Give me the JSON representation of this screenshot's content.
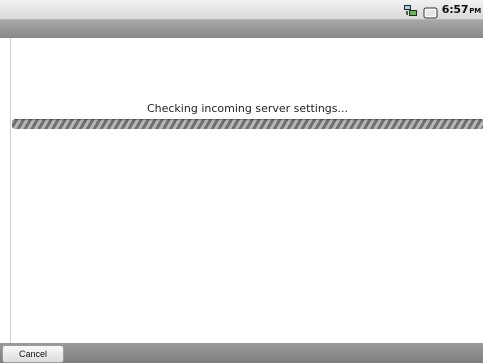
{
  "status_bar": {
    "time": "6:57",
    "ampm": "PM",
    "icons": [
      "network-icon",
      "battery-icon"
    ]
  },
  "main": {
    "progress_message": "Checking incoming server settings...",
    "progress_state": "indeterminate"
  },
  "bottom_bar": {
    "cancel_label": "Cancel"
  }
}
